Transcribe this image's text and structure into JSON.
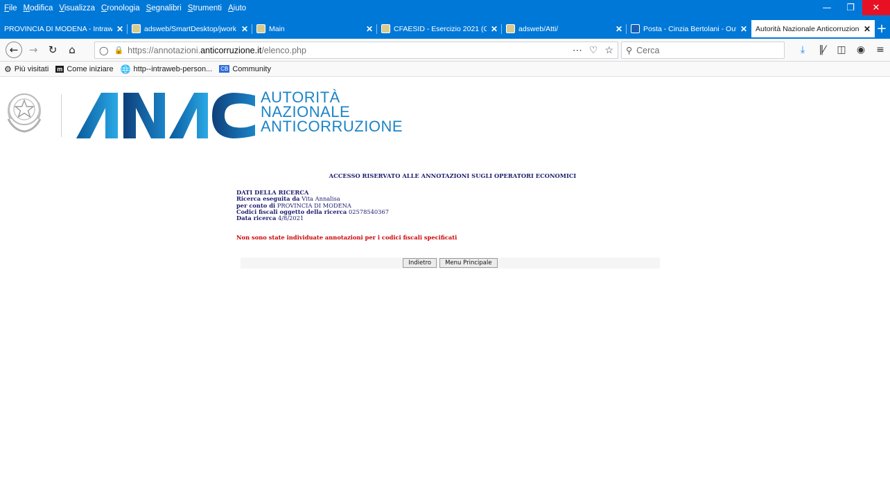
{
  "browser": {
    "menu": [
      "File",
      "Modifica",
      "Visualizza",
      "Cronologia",
      "Segnalibri",
      "Strumenti",
      "Aiuto"
    ],
    "tabs": [
      {
        "title": "PROVINCIA DI MODENA - Intraw",
        "icon": "none"
      },
      {
        "title": "adsweb/SmartDesktop/jwork",
        "icon": "adsweb-icon"
      },
      {
        "title": "Main",
        "icon": "adsweb-icon"
      },
      {
        "title": "CFAESID - Esercizio 2021 (Ge",
        "icon": "adsweb-icon"
      },
      {
        "title": "adsweb/Atti/",
        "icon": "adsweb-icon"
      },
      {
        "title": "Posta - Cinzia Bertolani - Out",
        "icon": "outlook-icon"
      },
      {
        "title": "Autorità Nazionale Anticorruzione",
        "icon": "none",
        "active": true
      }
    ],
    "url_prefix": "https://annotazioni.",
    "url_domain": "anticorruzione.it",
    "url_suffix": "/elenco.php",
    "search_placeholder": "Cerca",
    "bookmarks": [
      {
        "label": "Più visitati",
        "icon": "gear-icon"
      },
      {
        "label": "Come iniziare",
        "icon": "m-icon"
      },
      {
        "label": "http--intraweb-person...",
        "icon": "globe-icon"
      },
      {
        "label": "Community",
        "icon": "community-icon"
      }
    ],
    "colors": {
      "chrome_blue": "#0078d7",
      "close_red": "#e81123"
    }
  },
  "page": {
    "logo_text": "ANAC",
    "org_name_line1": "AUTORITÀ",
    "org_name_line2": "NAZIONALE",
    "org_name_line3": "ANTICORRUZIONE",
    "heading": "ACCESSO RISERVATO ALLE ANNOTAZIONI SUGLI OPERATORI ECONOMICI",
    "section_title": "DATI DELLA RICERCA",
    "performed_by_label": "Ricerca eseguita da",
    "performed_by_value": "Vita Annalisa",
    "on_behalf_label": "per conto di",
    "on_behalf_value": "PROVINCIA DI MODENA",
    "tax_codes_label": "Codici fiscali oggetto della ricerca",
    "tax_codes_value": "02578540367",
    "date_label": "Data ricerca",
    "date_value": "4/8/2021",
    "no_result_message": "Non sono state individuate annotazioni per i codici fiscali specificati",
    "back_button": "Indietro",
    "main_menu_button": "Menu Principale",
    "colors": {
      "heading": "#1c1c6e",
      "error": "#cc0000",
      "brand_blue": "#1b84c8"
    }
  }
}
